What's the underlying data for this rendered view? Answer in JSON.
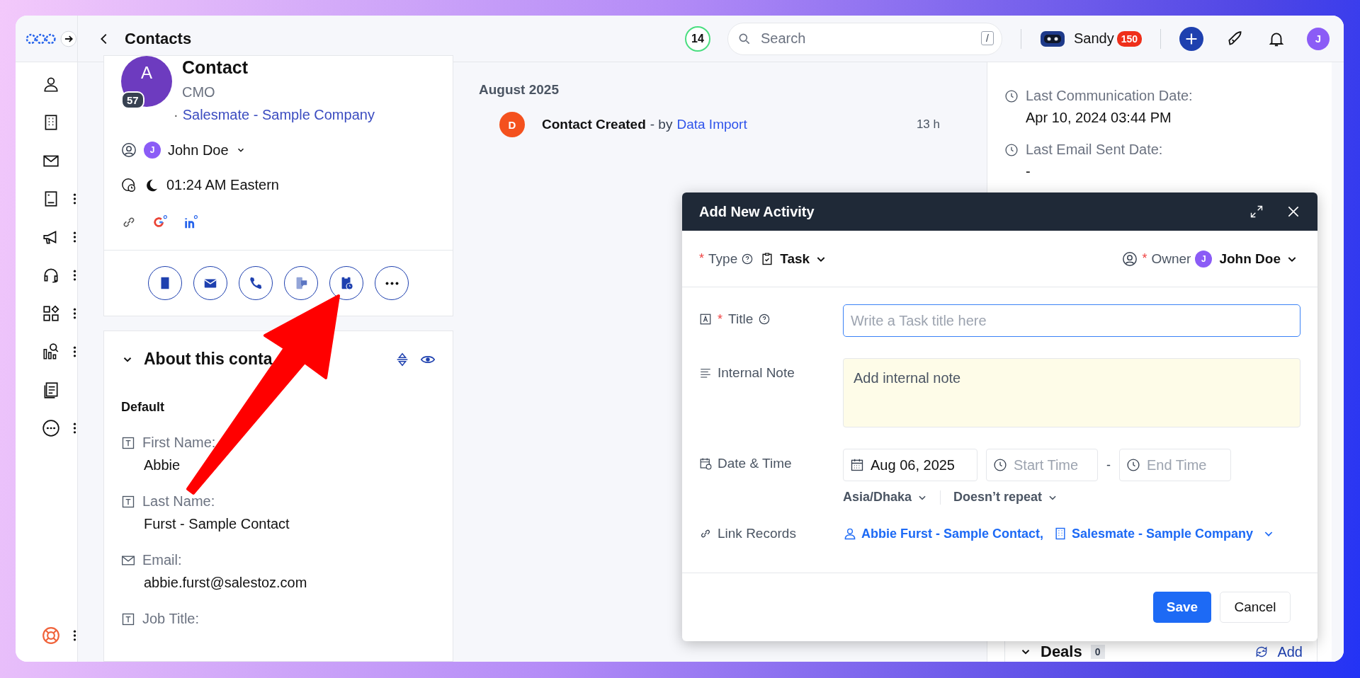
{
  "topbar": {
    "title": "Contacts",
    "counter": "14",
    "search": {
      "placeholder": "Search",
      "shortcut": "/"
    },
    "user": {
      "name": "Sandy",
      "badge": "150"
    },
    "avatar": "J"
  },
  "rail": {
    "items": [
      {
        "kind": "person",
        "menu": false
      },
      {
        "kind": "building",
        "menu": false
      },
      {
        "kind": "mail",
        "menu": false
      },
      {
        "kind": "invoice",
        "menu": true
      },
      {
        "kind": "megaphone",
        "menu": true
      },
      {
        "kind": "headset",
        "menu": true
      },
      {
        "kind": "apps",
        "menu": true
      },
      {
        "kind": "report",
        "menu": true
      },
      {
        "kind": "document",
        "menu": false
      },
      {
        "kind": "more",
        "menu": true
      }
    ],
    "bottom": {
      "kind": "lifebuoy",
      "menu": true
    }
  },
  "contact": {
    "name": "Contact",
    "avatar": "A",
    "score": "57",
    "job_title": "CMO",
    "separator": "·",
    "company": "Salesmate - Sample Company",
    "owner": {
      "avatar": "J",
      "name": "John Doe"
    },
    "time": "01:24 AM Eastern",
    "actions": [
      {
        "kind": "note"
      },
      {
        "kind": "email"
      },
      {
        "kind": "call"
      },
      {
        "kind": "sms"
      },
      {
        "kind": "task"
      },
      {
        "kind": "more"
      }
    ]
  },
  "about": {
    "title": "About this conta",
    "section": "Default",
    "fields": [
      {
        "kind": "text",
        "label": "First Name:",
        "value": "Abbie"
      },
      {
        "kind": "text",
        "label": "Last Name:",
        "value": "Furst - Sample Contact"
      },
      {
        "kind": "email",
        "label": "Email:",
        "value": "abbie.furst@salestoz.com"
      },
      {
        "kind": "text",
        "label": "Job Title:"
      }
    ]
  },
  "timeline": {
    "month": "August 2025",
    "events": [
      {
        "avatar": "D",
        "title": "Contact Created",
        "by": "- by",
        "source": "Data Import",
        "age": "13 h"
      }
    ]
  },
  "details": [
    {
      "label": "Last Communication Date:",
      "value": "Apr 10, 2024 03:44 PM"
    },
    {
      "label": "Last Email Sent Date:",
      "value": "-"
    }
  ],
  "deals": {
    "title": "Deals",
    "count": "0",
    "add": "Add"
  },
  "modal": {
    "title": "Add New Activity",
    "type": {
      "mark": "*",
      "label": "Type",
      "value": "Task"
    },
    "owner": {
      "mark": "*",
      "label": "Owner",
      "avatar": "J",
      "name": "John Doe"
    },
    "title_field": {
      "mark": "*",
      "label": "Title",
      "placeholder": "Write a Task title here"
    },
    "note": {
      "label": "Internal Note",
      "placeholder": "Add internal note"
    },
    "date": {
      "label": "Date & Time",
      "date": "Aug 06, 2025",
      "start_placeholder": "Start Time",
      "separator": "-",
      "end_placeholder": "End Time",
      "timezone": "Asia/Dhaka",
      "repeat": "Doesn’t repeat"
    },
    "links": {
      "label": "Link Records",
      "records": [
        {
          "kind": "contact",
          "name": "Abbie Furst - Sample Contact,"
        },
        {
          "kind": "company",
          "name": "Salesmate - Sample Company"
        }
      ]
    },
    "buttons": {
      "save": "Save",
      "cancel": "Cancel"
    }
  }
}
